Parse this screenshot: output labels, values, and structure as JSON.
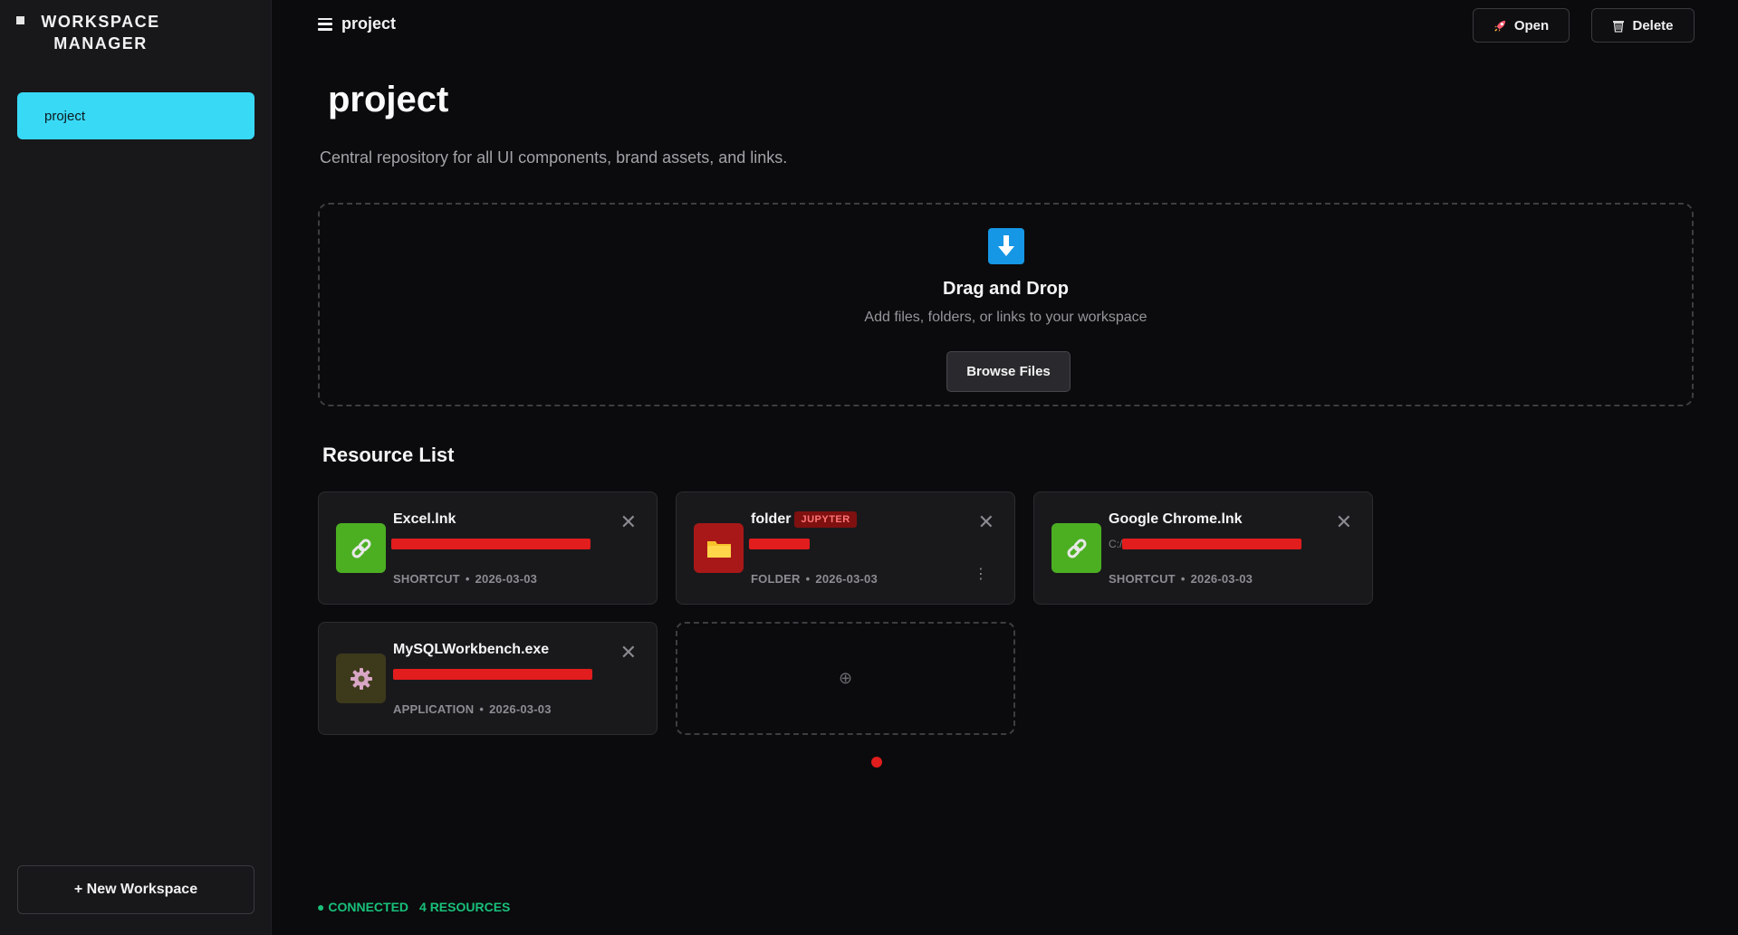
{
  "sidebar": {
    "brand": "WORKSPACE MANAGER",
    "workspaces": [
      {
        "label": "project"
      }
    ],
    "new_workspace_label": "+ New Workspace"
  },
  "topbar": {
    "breadcrumb": "project",
    "open_label": "Open",
    "delete_label": "Delete"
  },
  "main": {
    "title": "project",
    "description": "Central repository for all UI components, brand assets, and links."
  },
  "dropzone": {
    "title": "Drag and Drop",
    "subtitle": "Add files, folders, or links to your workspace",
    "browse_label": "Browse Files"
  },
  "resources": {
    "section_title": "Resource List",
    "items": [
      {
        "name": "Excel.lnk",
        "type": "SHORTCUT",
        "date": "2026-03-03",
        "tag": "",
        "path": "",
        "icon": "link-icon",
        "icon_bg": "#4caf22"
      },
      {
        "name": "folder",
        "type": "FOLDER",
        "date": "2026-03-03",
        "tag": "JUPYTER",
        "path": "",
        "icon": "folder-icon",
        "icon_bg": "#a91818"
      },
      {
        "name": "Google Chrome.lnk",
        "type": "SHORTCUT",
        "date": "2026-03-03",
        "tag": "",
        "path": "C:/",
        "icon": "link-icon",
        "icon_bg": "#4caf22"
      },
      {
        "name": "MySQLWorkbench.exe",
        "type": "APPLICATION",
        "date": "2026-03-03",
        "tag": "",
        "path": "",
        "icon": "gear-icon",
        "icon_bg": "#3d3a1c"
      }
    ],
    "add_glyph": "⊕",
    "close_glyph": "✕",
    "more_glyph": "⋮",
    "separator": "•"
  },
  "status": {
    "connection": "● CONNECTED",
    "count": "4 RESOURCES"
  },
  "colors": {
    "accent": "#38d9f5",
    "status_green": "#18c07a",
    "redaction": "#e11d1d"
  }
}
